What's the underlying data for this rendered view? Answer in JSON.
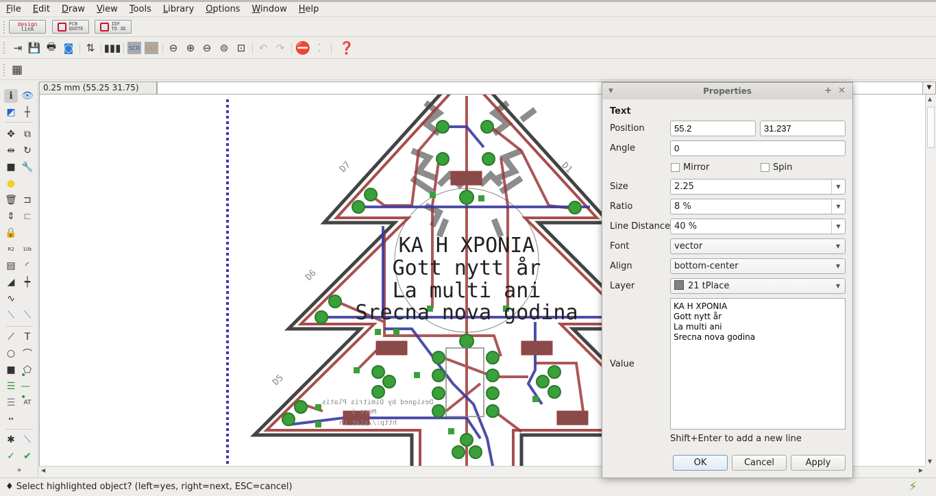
{
  "menu": [
    "File",
    "Edit",
    "Draw",
    "View",
    "Tools",
    "Library",
    "Options",
    "Window",
    "Help"
  ],
  "brand_toolbar": [
    {
      "line1": "design",
      "line2": "link"
    },
    {
      "line1": "PCB",
      "line2": "QUOTE"
    },
    {
      "line1": "IDF",
      "line2": "TO 3D"
    }
  ],
  "main_toolbar": {
    "scr_label": "SCR",
    "ulp_label": "ULP",
    "icons": [
      "open-icon",
      "save-icon",
      "print-icon",
      "cam-icon",
      "board-schematic-switch-icon",
      "layers-icon",
      "script-icon",
      "ulp-icon",
      "zoom-fit-icon",
      "zoom-in-icon",
      "zoom-out-icon",
      "zoom-redraw-icon",
      "zoom-select-icon",
      "undo-icon",
      "redo-icon",
      "stop-icon",
      "go-icon",
      "help-icon"
    ]
  },
  "grid_toolbar": {
    "icon": "grid-icon"
  },
  "coord_readout": "0.25 mm (55.25 31.75)",
  "command_input": "",
  "status": {
    "message": "Select highlighted object? (left=yes, right=next, ESC=cancel)",
    "icon": "lightning-icon"
  },
  "canvas": {
    "text_lines": [
      "KA H XPONIA",
      "Gott nytt år",
      "La multi ani",
      "Srecna nova godina"
    ],
    "part_labels": [
      "D7",
      "D1",
      "D6",
      "D5"
    ],
    "mirrored_text": [
      "Designed by Dimitris Platis",
      "More i",
      "http://plat",
      "ch"
    ],
    "colors": {
      "outline": "#444444",
      "top_copper": "#9e3a3a",
      "bottom_copper": "#3b3b9e",
      "pads": "#3aa03a",
      "silkscreen": "#808080",
      "frame": "#3b3bb0"
    }
  },
  "dialog": {
    "title": "Properties",
    "section": "Text",
    "position_label": "Position",
    "position_x": "55.2",
    "position_y": "31.237",
    "angle_label": "Angle",
    "angle": "0",
    "mirror_label": "Mirror",
    "mirror": false,
    "spin_label": "Spin",
    "spin": false,
    "size_label": "Size",
    "size": "2.25",
    "ratio_label": "Ratio",
    "ratio": "8 %",
    "line_distance_label": "Line Distance",
    "line_distance": "40 %",
    "font_label": "Font",
    "font": "vector",
    "align_label": "Align",
    "align": "bottom-center",
    "layer_label": "Layer",
    "layer": "21 tPlace",
    "layer_color": "#808080",
    "value_label": "Value",
    "value": "KA H XPONIA\nGott nytt år\nLa multi ani\nSrecna nova godina",
    "hint": "Shift+Enter to add a new line",
    "ok": "OK",
    "cancel": "Cancel",
    "apply": "Apply"
  }
}
